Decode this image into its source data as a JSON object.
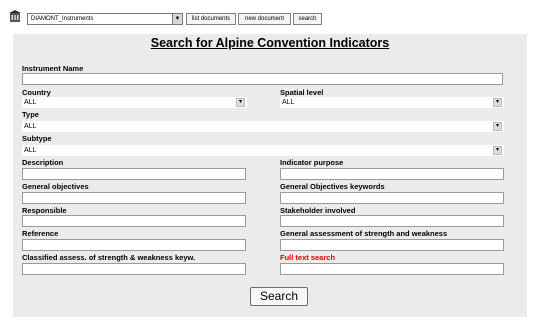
{
  "toolbar": {
    "app_icon": "building-icon",
    "database_select_value": "DIAMONT_Instruments",
    "list_documents_label": "list documents",
    "new_document_label": "new document",
    "search_label": "search"
  },
  "form": {
    "heading": "Search for Alpine Convention Indicators",
    "instrument_name_label": "Instrument Name",
    "country_label": "Country",
    "country_value": "ALL",
    "spatial_level_label": "Spatial level",
    "spatial_level_value": "ALL",
    "type_label": "Type",
    "type_value": "ALL",
    "subtype_label": "Subtype",
    "subtype_value": "ALL",
    "description_label": "Description",
    "indicator_purpose_label": "Indicator purpose",
    "general_objectives_label": "General objectives",
    "general_objectives_keywords_label": "General Objectives keywords",
    "responsible_label": "Responsible",
    "stakeholder_label": "Stakeholder involved",
    "reference_label": "Reference",
    "general_assessment_label": "General assessment of strength and weakness",
    "classified_assess_label": "Classified assess. of strength & weakness keyw.",
    "full_text_search_label": "Full text search",
    "search_button_label": "Search"
  },
  "colors": {
    "panel_background": "#ebebeb",
    "full_text_label": "#e00000"
  }
}
